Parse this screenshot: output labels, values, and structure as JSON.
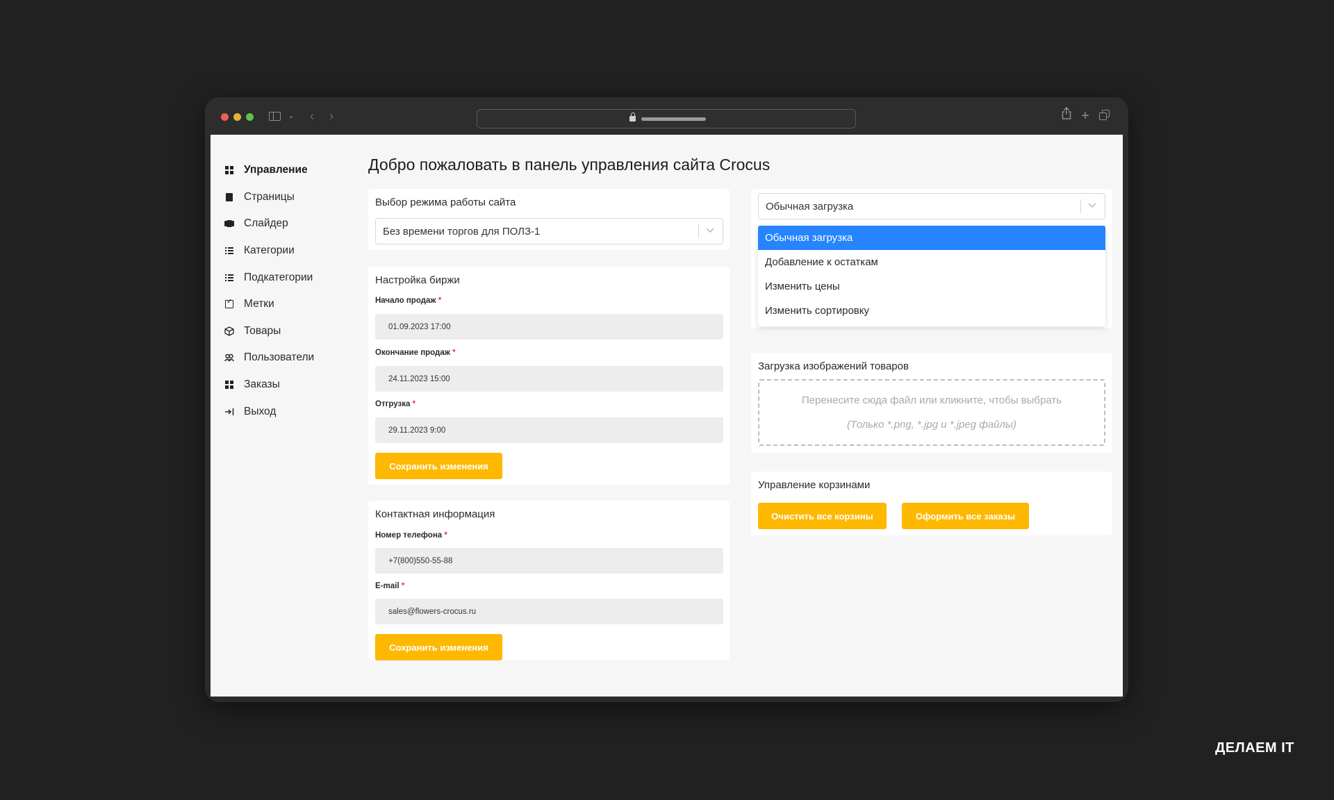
{
  "browser": {
    "traffic_lights": [
      "close",
      "minimize",
      "maximize"
    ],
    "icons": [
      "sidebar-toggle-icon",
      "chevron-down-icon",
      "back-icon",
      "forward-icon",
      "lock-icon",
      "share-icon",
      "plus-icon",
      "tabs-icon"
    ]
  },
  "sidebar": {
    "items": [
      {
        "label": "Управление",
        "icon": "dashboard-icon",
        "active": true
      },
      {
        "label": "Страницы",
        "icon": "pages-icon"
      },
      {
        "label": "Слайдер",
        "icon": "slider-icon"
      },
      {
        "label": "Категории",
        "icon": "list-icon"
      },
      {
        "label": "Подкатегории",
        "icon": "list-icon"
      },
      {
        "label": "Метки",
        "icon": "tag-icon"
      },
      {
        "label": "Товары",
        "icon": "box-icon"
      },
      {
        "label": "Пользователи",
        "icon": "users-icon"
      },
      {
        "label": "Заказы",
        "icon": "orders-icon"
      },
      {
        "label": "Выход",
        "icon": "logout-icon"
      }
    ]
  },
  "main": {
    "title": "Добро пожаловать в панель управления сайта Crocus",
    "mode_card": {
      "title": "Выбор режима работы сайта",
      "selected": "Без времени торгов для ПОЛЗ-1"
    },
    "exchange_card": {
      "title": "Настройка биржи",
      "fields": [
        {
          "label": "Начало продаж",
          "value": "01.09.2023 17:00"
        },
        {
          "label": "Окончание продаж",
          "value": "24.11.2023 15:00"
        },
        {
          "label": "Отгрузка",
          "value": "29.11.2023 9:00"
        }
      ],
      "required_mark": "*",
      "save_label": "Сохранить изменения"
    },
    "contact_card": {
      "title": "Контактная информация",
      "fields": [
        {
          "label": "Номер телефона",
          "value": "+7(800)550-55-88"
        },
        {
          "label": "E-mail",
          "value": "sales@flowers-crocus.ru"
        }
      ],
      "required_mark": "*",
      "save_label": "Сохранить изменения"
    },
    "upload_mode": {
      "selected": "Обычная загрузка",
      "options": [
        "Обычная загрузка",
        "Добавление к остаткам",
        "Изменить цены",
        "Изменить сортировку"
      ]
    },
    "images_card": {
      "title": "Загрузка изображений товаров",
      "drop_text": "Перенесите сюда файл или кликните, чтобы выбрать",
      "drop_hint": "(Только *.png, *.jpg и *.jpeg файлы)"
    },
    "carts_card": {
      "title": "Управление корзинами",
      "clear_label": "Очистить все корзины",
      "checkout_label": "Оформить все заказы"
    }
  },
  "brand": "ДЕЛАЕМ IT",
  "colors": {
    "accent": "#ffb800",
    "selected_option": "#2684ff",
    "background": "#212121"
  }
}
